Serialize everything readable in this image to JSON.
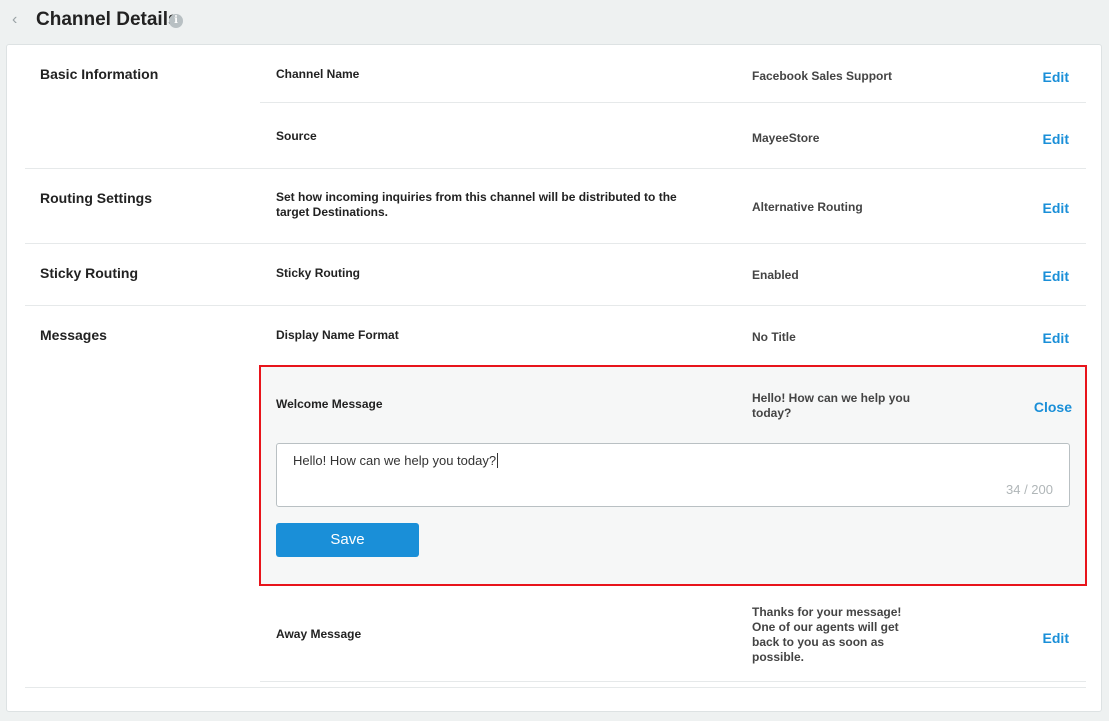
{
  "header": {
    "title": "Channel Details",
    "info_glyph": "i"
  },
  "icons": {
    "back": "chevron-left-icon",
    "info": "info-icon"
  },
  "sections": {
    "basic_information": "Basic Information",
    "routing_settings": "Routing Settings",
    "sticky_routing": "Sticky Routing",
    "messages": "Messages"
  },
  "rows": {
    "channel_name": {
      "label": "Channel Name",
      "value": "Facebook Sales Support",
      "action": "Edit"
    },
    "source": {
      "label": "Source",
      "value": "MayeeStore",
      "action": "Edit"
    },
    "routing": {
      "label": "Set how incoming inquiries from this channel will be distributed to the target Destinations.",
      "value": "Alternative Routing",
      "action": "Edit"
    },
    "sticky": {
      "label": "Sticky Routing",
      "value": "Enabled",
      "action": "Edit"
    },
    "display_name": {
      "label": "Display Name Format",
      "value": "No Title",
      "action": "Edit"
    },
    "away_message": {
      "label": "Away Message",
      "value": "Thanks for your message! One of our agents will get back to you as soon as possible.",
      "action": "Edit"
    }
  },
  "welcome_editor": {
    "label": "Welcome Message",
    "value": "Hello! How can we help you today?",
    "close_label": "Close",
    "input_value": "Hello! How can we help you today?",
    "char_count": "34 / 200",
    "save_label": "Save"
  },
  "colors": {
    "accent": "#1a8fd8",
    "highlight_border": "#e8141b"
  }
}
